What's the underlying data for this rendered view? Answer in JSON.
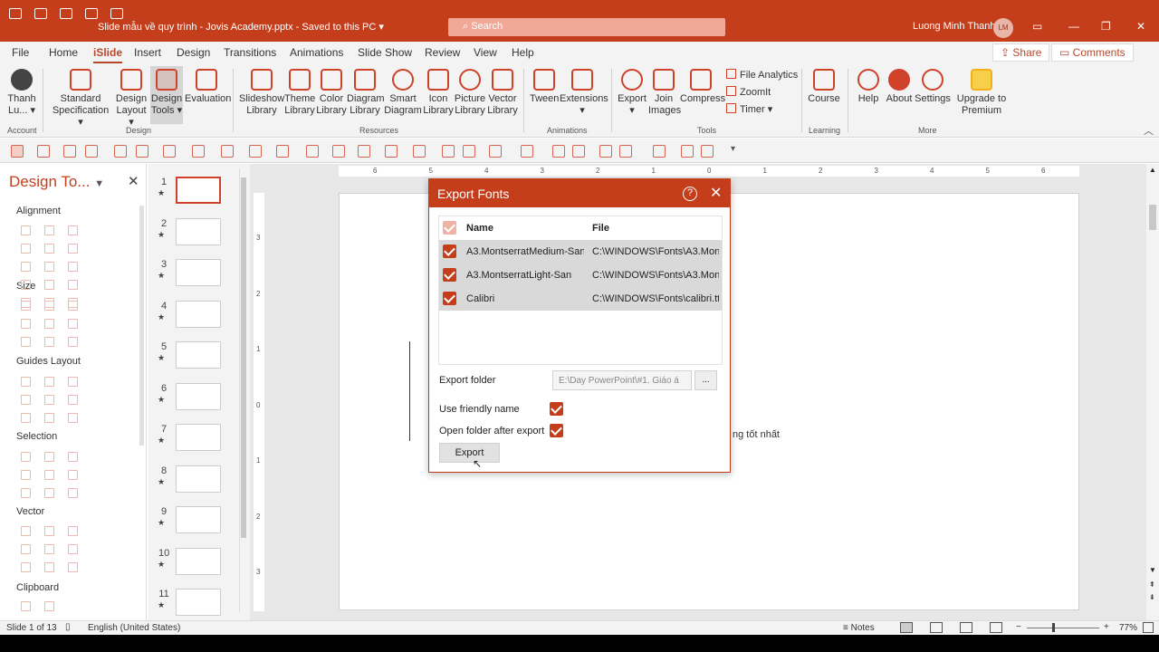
{
  "titlebar": {
    "doc_title": "Slide mẫu về quy trình - Jovis Academy.pptx  -  Saved to this PC ▾",
    "search_placeholder": "Search",
    "user_name": "Luong Minh Thanh",
    "user_initials": "LM",
    "min": "—",
    "restore": "❐",
    "close": "✕",
    "ribbon_opts": "▭"
  },
  "menu": {
    "tabs": [
      "File",
      "Home",
      "iSlide",
      "Insert",
      "Design",
      "Transitions",
      "Animations",
      "Slide Show",
      "Review",
      "View",
      "Help"
    ],
    "active": "iSlide",
    "share": "Share",
    "comments": "Comments"
  },
  "ribbon": {
    "account": {
      "label": "Thanh Lu... ▾",
      "group": "Account"
    },
    "design": {
      "items": [
        "Standard Specification ▾",
        "Design Layout ▾",
        "Design Tools ▾",
        "Evaluation"
      ],
      "group": "Design"
    },
    "resources": {
      "items": [
        "Slideshow Library",
        "Theme Library",
        "Color Library",
        "Diagram Library",
        "Smart Diagram",
        "Icon Library",
        "Picture Library",
        "Vector Library"
      ],
      "group": "Resources"
    },
    "animations": {
      "items": [
        "Tween",
        "Extensions ▾"
      ],
      "group": "Animations"
    },
    "tools": {
      "items": [
        "Export ▾",
        "Join Images",
        "Compress"
      ],
      "small": [
        "File Analytics",
        "ZoomIt",
        "Timer ▾"
      ],
      "group": "Tools"
    },
    "learning": {
      "items": [
        "Course"
      ],
      "group": "Learning"
    },
    "more": {
      "items": [
        "Help",
        "About",
        "Settings",
        "Upgrade to Premium"
      ],
      "group": "More"
    }
  },
  "pane": {
    "title": "Design To...",
    "sections": [
      "Alignment",
      "Size",
      "Guides Layout",
      "Selection",
      "Vector",
      "Clipboard"
    ]
  },
  "thumbs": [
    "1",
    "2",
    "3",
    "4",
    "5",
    "6",
    "7",
    "8",
    "9",
    "10",
    "11"
  ],
  "slide_text": {
    "tail": "ng tốt nhất"
  },
  "ruler_h": [
    "6",
    "5",
    "4",
    "3",
    "2",
    "1",
    "0",
    "1",
    "2",
    "3",
    "4",
    "5",
    "6"
  ],
  "ruler_v": [
    "3",
    "2",
    "1",
    "0",
    "1",
    "2",
    "3"
  ],
  "dialog": {
    "title": "Export Fonts",
    "col_name": "Name",
    "col_file": "File",
    "rows": [
      {
        "name": "A3.MontserratMedium-San",
        "file": "C:\\WINDOWS\\Fonts\\A3.Mont"
      },
      {
        "name": "A3.MontserratLight-San",
        "file": "C:\\WINDOWS\\Fonts\\A3.Mont"
      },
      {
        "name": "Calibri",
        "file": "C:\\WINDOWS\\Fonts\\calibri.tt"
      }
    ],
    "folder_label": "Export folder",
    "folder_value": "E:\\Day PowerPoint\\#1. Giáo á",
    "browse": "...",
    "friendly_label": "Use friendly name",
    "open_label": "Open folder after export",
    "export": "Export"
  },
  "status": {
    "slide": "Slide 1 of 13",
    "language": "English (United States)",
    "notes": "Notes",
    "zoom": "77%"
  },
  "colors": {
    "accent": "#c43e1c"
  }
}
